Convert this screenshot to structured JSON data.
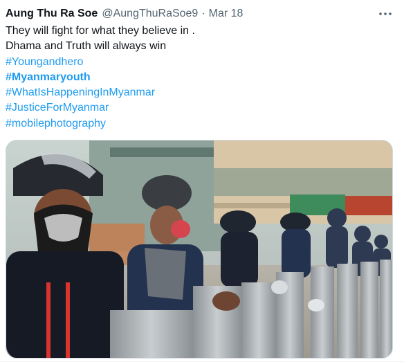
{
  "tweet": {
    "author_name": "Aung Thu Ra Soe",
    "author_handle": "@AungThuRaSoe9",
    "separator": "·",
    "date": "Mar 18",
    "text_lines": [
      "They will fight for what they believe in .",
      "Dhama and Truth will always win"
    ],
    "hashtags": [
      "#Youngandhero",
      "#Myanmaryouth",
      "#WhatIsHappeningInMyanmar",
      "#JusticeForMyanmar",
      "#mobilephotography"
    ],
    "more_icon": "more-horizontal-icon",
    "media": {
      "type": "photo"
    }
  },
  "colors": {
    "text": "#0f1419",
    "secondary": "#536471",
    "link": "#1d9bf0",
    "border": "#cfd9de"
  }
}
